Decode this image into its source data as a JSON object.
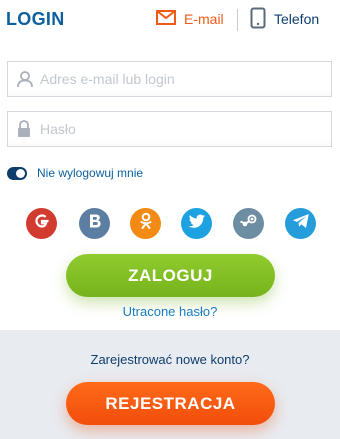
{
  "header": {
    "title": "LOGIN",
    "tabs": [
      {
        "label": "E-mail",
        "icon": "envelope-icon",
        "active": true
      },
      {
        "label": "Telefon",
        "icon": "phone-icon",
        "active": false
      }
    ]
  },
  "form": {
    "email_placeholder": "Adres e-mail lub login",
    "email_value": "",
    "password_placeholder": "Hasło",
    "password_value": "",
    "remember_label": "Nie wylogowuj mnie",
    "remember_checked": true
  },
  "social": [
    {
      "name": "google",
      "icon": "google-icon",
      "color": "#d23c30"
    },
    {
      "name": "vk",
      "icon": "vk-icon",
      "color": "#5d7ea3"
    },
    {
      "name": "odnoklassniki",
      "icon": "odnoklassniki-icon",
      "color": "#f28a13"
    },
    {
      "name": "twitter",
      "icon": "twitter-icon",
      "color": "#1ea1e0"
    },
    {
      "name": "steam",
      "icon": "steam-icon",
      "color": "#6d8ea2"
    },
    {
      "name": "telegram",
      "icon": "telegram-icon",
      "color": "#259ddb"
    }
  ],
  "actions": {
    "login_label": "ZALOGUJ",
    "forgot_label": "Utracone hasło?",
    "register_prompt": "Zarejestrować nowe konto?",
    "register_label": "REJESTRACJA"
  },
  "colors": {
    "accent_orange": "#f05a15",
    "primary_blue": "#0d5f9e",
    "login_green": "#84c125",
    "register_orange": "#ff5a12",
    "footer_bg": "#e8ebf0"
  }
}
